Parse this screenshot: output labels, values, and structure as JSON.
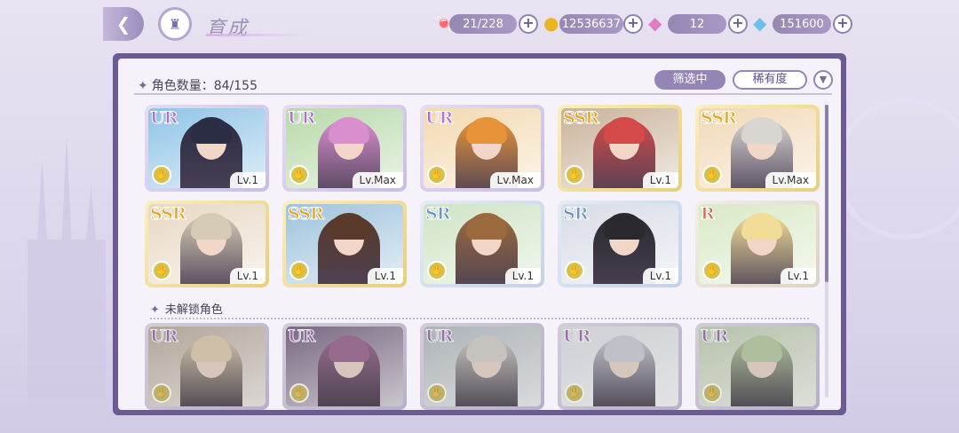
{
  "header": {
    "title": "育成"
  },
  "resources": [
    {
      "icon": "candy-icon",
      "value": "21/228"
    },
    {
      "icon": "gold-coin-icon",
      "value": "12536637"
    },
    {
      "icon": "pink-diamond-icon",
      "value": "12"
    },
    {
      "icon": "blue-diamond-icon",
      "value": "151600"
    }
  ],
  "panel": {
    "count_label": "角色数量：84/155",
    "filter_label": "筛选中",
    "rarity_label": "稀有度",
    "locked_section_label": "未解锁角色"
  },
  "owned": [
    {
      "rarity": "UR",
      "level": "Lv.1",
      "hair": "#2b2d44",
      "bg": "#8ec4e6"
    },
    {
      "rarity": "UR",
      "level": "Lv.Max",
      "hair": "#d98fce",
      "bg": "#b7d9a8"
    },
    {
      "rarity": "UR",
      "level": "Lv.Max",
      "hair": "#e7933a",
      "bg": "#f3d9b0"
    },
    {
      "rarity": "SSR",
      "level": "Lv.1",
      "hair": "#d44a4a",
      "bg": "#c9b39a"
    },
    {
      "rarity": "SSR",
      "level": "Lv.Max",
      "hair": "#d9d6d2",
      "bg": "#f2d8b6"
    },
    {
      "rarity": "SSR",
      "level": "Lv.1",
      "hair": "#d6cbb5",
      "bg": "#e8d8c4"
    },
    {
      "rarity": "SSR",
      "level": "Lv.1",
      "hair": "#5a3a2a",
      "bg": "#9ec3dc"
    },
    {
      "rarity": "SR",
      "level": "Lv.1",
      "hair": "#9a6a3e",
      "bg": "#cfe4c4"
    },
    {
      "rarity": "SR",
      "level": "Lv.1",
      "hair": "#2a2a2e",
      "bg": "#d8dce6"
    },
    {
      "rarity": "R",
      "level": "Lv.1",
      "hair": "#f1dc98",
      "bg": "#d9e9c6"
    }
  ],
  "locked": [
    {
      "rarity": "UR",
      "hair": "#e6cfa8",
      "bg": "#c9b4a0"
    },
    {
      "rarity": "UR",
      "hair": "#b56ea6",
      "bg": "#8a6f9a"
    },
    {
      "rarity": "UR",
      "hair": "#d8d4cc",
      "bg": "#b9c4cc"
    },
    {
      "rarity": "UR",
      "hair": "#cfd2de",
      "bg": "#dfe2ea"
    },
    {
      "rarity": "UR",
      "hair": "#b7d39a",
      "bg": "#c3d6b0"
    }
  ],
  "colors": {
    "panel_border": "#6b5a94",
    "filter_active": "#9385b6"
  }
}
